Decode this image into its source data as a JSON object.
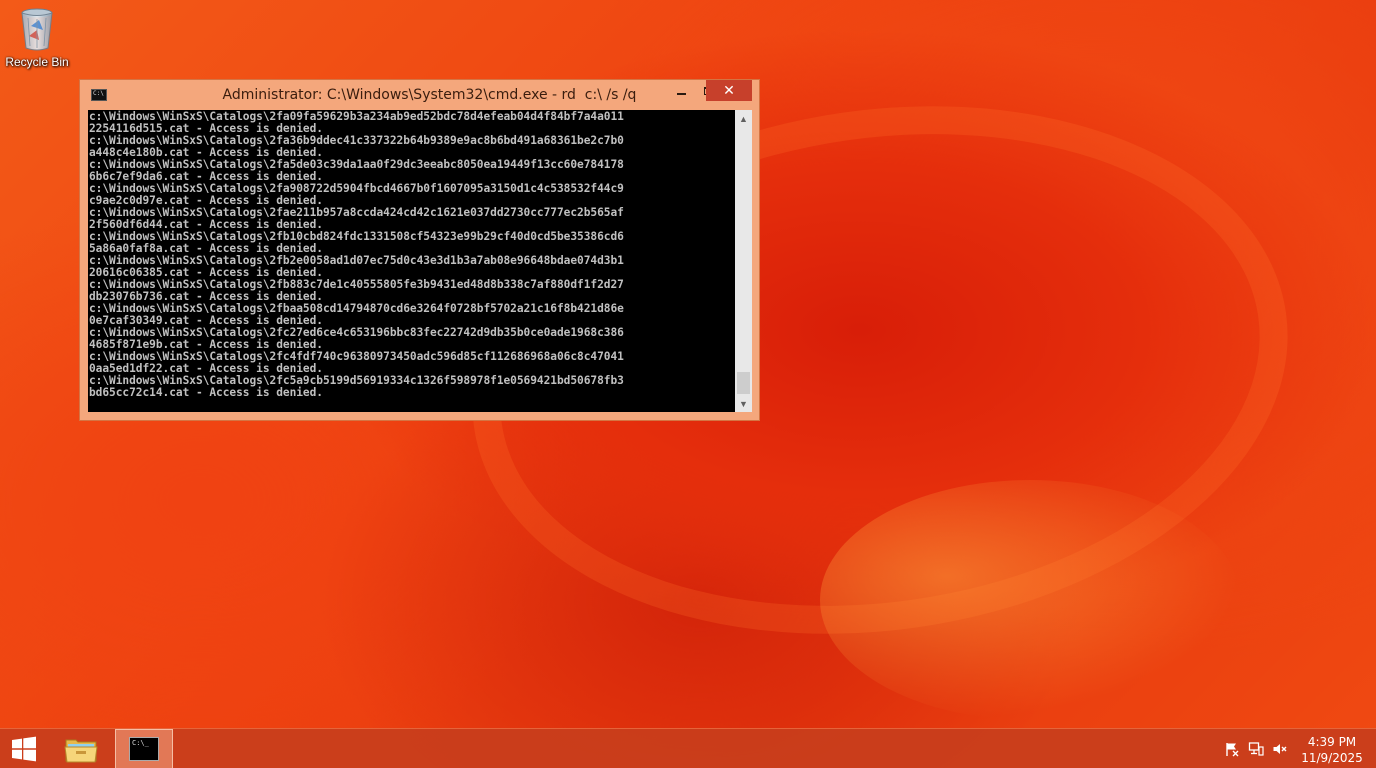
{
  "desktop": {
    "icons": [
      {
        "label": "Recycle Bin",
        "icon": "recycle-bin-icon"
      }
    ]
  },
  "window": {
    "title": "Administrator: C:\\Windows\\System32\\cmd.exe - rd  c:\\ /s /q",
    "controls": {
      "minimize": "minimize",
      "maximize": "maximize",
      "close": "✕"
    },
    "console_lines": [
      "c:\\Windows\\WinSxS\\Catalogs\\2fa09fa59629b3a234ab9ed52bdc78d4efeab04d4f84bf7a4a011",
      "2254116d515.cat - Access is denied.",
      "c:\\Windows\\WinSxS\\Catalogs\\2fa36b9ddec41c337322b64b9389e9ac8b6bd491a68361be2c7b0",
      "a448c4e180b.cat - Access is denied.",
      "c:\\Windows\\WinSxS\\Catalogs\\2fa5de03c39da1aa0f29dc3eeabc8050ea19449f13cc60e784178",
      "6b6c7ef9da6.cat - Access is denied.",
      "c:\\Windows\\WinSxS\\Catalogs\\2fa908722d5904fbcd4667b0f1607095a3150d1c4c538532f44c9",
      "c9ae2c0d97e.cat - Access is denied.",
      "c:\\Windows\\WinSxS\\Catalogs\\2fae211b957a8ccda424cd42c1621e037dd2730cc777ec2b565af",
      "2f560df6d44.cat - Access is denied.",
      "c:\\Windows\\WinSxS\\Catalogs\\2fb10cbd824fdc1331508cf54323e99b29cf40d0cd5be35386cd6",
      "5a86a0faf8a.cat - Access is denied.",
      "c:\\Windows\\WinSxS\\Catalogs\\2fb2e0058ad1d07ec75d0c43e3d1b3a7ab08e96648bdae074d3b1",
      "20616c06385.cat - Access is denied.",
      "c:\\Windows\\WinSxS\\Catalogs\\2fb883c7de1c40555805fe3b9431ed48d8b338c7af880df1f2d27",
      "db23076b736.cat - Access is denied.",
      "c:\\Windows\\WinSxS\\Catalogs\\2fbaa508cd14794870cd6e3264f0728bf5702a21c16f8b421d86e",
      "0e7caf30349.cat - Access is denied.",
      "c:\\Windows\\WinSxS\\Catalogs\\2fc27ed6ce4c653196bbc83fec22742d9db35b0ce0ade1968c386",
      "4685f871e9b.cat - Access is denied.",
      "c:\\Windows\\WinSxS\\Catalogs\\2fc4fdf740c96380973450adc596d85cf112686968a06c8c47041",
      "0aa5ed1df22.cat - Access is denied.",
      "c:\\Windows\\WinSxS\\Catalogs\\2fc5a9cb5199d56919334c1326f598978f1e0569421bd50678fb3",
      "bd65cc72c14.cat - Access is denied."
    ]
  },
  "taskbar": {
    "start_icon": "windows-logo-icon",
    "pinned": [
      {
        "name": "file-explorer",
        "icon": "folder-icon"
      },
      {
        "name": "cmd",
        "icon": "command-prompt-icon",
        "active": true
      }
    ],
    "tray": {
      "icons": [
        "action-center-flag-icon",
        "network-icon",
        "speaker-muted-icon"
      ],
      "time": "4:39 PM",
      "date": "11/9/2025"
    }
  },
  "colors": {
    "desktop_accent": "#e8380e",
    "taskbar": "#c83e1c",
    "window_frame": "#f4a77c",
    "close_button": "#c7402b",
    "console_bg": "#000000",
    "console_text": "#c0c0c0"
  }
}
